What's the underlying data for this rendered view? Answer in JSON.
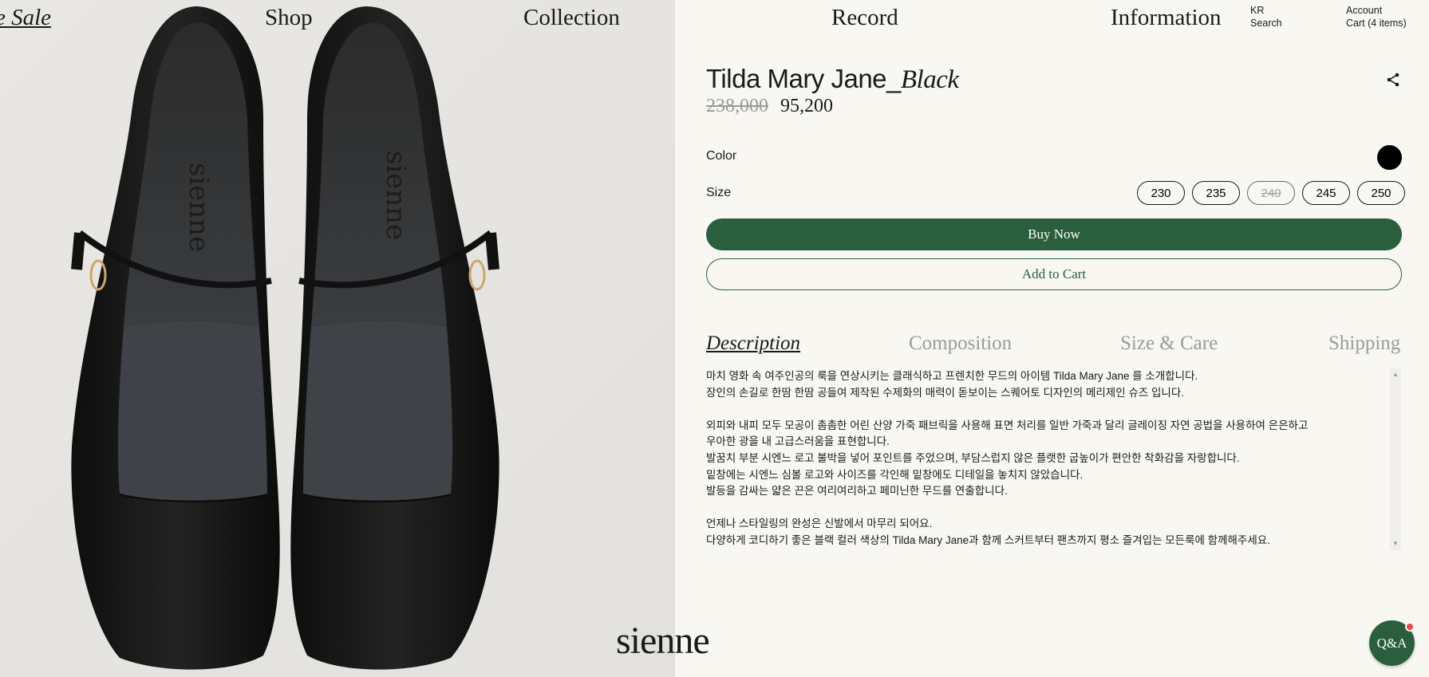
{
  "nav": {
    "sale": "e Sale",
    "shop": "Shop",
    "collection": "Collection",
    "record": "Record",
    "information": "Information"
  },
  "utility": {
    "language": "KR",
    "search": "Search",
    "account": "Account",
    "cart": "Cart (4 items)"
  },
  "product": {
    "name": "Tilda Mary Jane_",
    "variant": "Black",
    "original_price": "238,000",
    "sale_price": "95,200",
    "color_label": "Color",
    "selected_color": "#000000",
    "size_label": "Size",
    "sizes": [
      {
        "label": "230",
        "sold_out": false
      },
      {
        "label": "235",
        "sold_out": false
      },
      {
        "label": "240",
        "sold_out": true
      },
      {
        "label": "245",
        "sold_out": false
      },
      {
        "label": "250",
        "sold_out": false
      }
    ],
    "photo_brand_mark": "sienne"
  },
  "actions": {
    "buy_now": "Buy Now",
    "add_to_cart": "Add to Cart"
  },
  "tabs": [
    {
      "label": "Description",
      "active": true
    },
    {
      "label": "Composition",
      "active": false
    },
    {
      "label": "Size & Care",
      "active": false
    },
    {
      "label": "Shipping",
      "active": false
    }
  ],
  "description": {
    "lines": [
      "마치 영화 속 여주인공의 룩을 연상시키는 클래식하고 프렌치한 무드의 아이템 Tilda Mary Jane 를 소개합니다.",
      "장인의 손길로 한땀 한땀 공들여 제작된 수제화의 매력이 돋보이는 스퀘어토 디자인의 메리제인 슈즈 입니다.",
      "",
      "외피와 내피 모두 모공이 촘촘한 어린 산양 가죽 패브릭을 사용해 표면 처리를 일반 가죽과 달리 글레이징 자연 공법을 사용하여 은은하고",
      "우아한 광을 내 고급스러움을 표현합니다.",
      "발꿈치 부분 시엔느 로고 불박을 넣어 포인트를 주었으며, 부담스럽지 않은 플랫한 굽높이가 편안한 착화감을 자랑합니다.",
      "밑창에는 시엔느 심볼 로고와 사이즈를 각인해 밑창에도 디테일을 놓치지 않았습니다.",
      "발등을 감싸는 얇은 끈은 여리여리하고 페미닌한 무드를 연출합니다.",
      "",
      "언제나 스타일링의 완성은 신발에서 마무리 되어요.",
      "다양하게 코디하기 좋은 블랙 컬러 색상의 Tilda Mary Jane과 함께 스커트부터 팬츠까지 평소 즐겨입는 모든룩에 함께해주세요."
    ]
  },
  "brand": {
    "logo": "sienne"
  },
  "chat": {
    "label": "Q&A"
  },
  "colors": {
    "accent_green": "#2a5e3c",
    "background": "#f8f7f2",
    "photo_background": "#e7e5e1"
  }
}
